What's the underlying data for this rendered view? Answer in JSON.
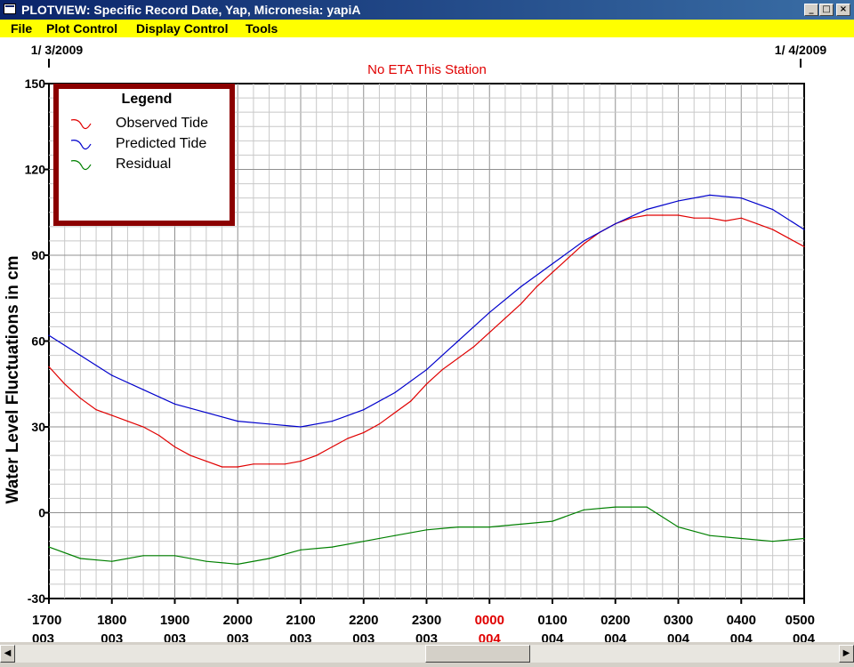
{
  "window": {
    "title": "PLOTVIEW: Specific Record Date, Yap, Micronesia: yapiA",
    "buttons": {
      "minimize": "_",
      "maximize": "□",
      "close": "×"
    }
  },
  "menu": [
    "File",
    "Plot Control",
    "Display Control",
    "Tools"
  ],
  "header": {
    "date_left": "1/ 3/2009",
    "date_right": "1/ 4/2009",
    "status": "No ETA This Station"
  },
  "chart_data": {
    "type": "line",
    "ylabel": "Water Level Fluctuations in cm",
    "ylim": [
      -30,
      150
    ],
    "yticks": [
      "150",
      "120",
      "90",
      "60",
      "30",
      "0",
      "-30"
    ],
    "xlim": [
      0,
      12
    ],
    "xticks": [
      {
        "time": "1700",
        "day": "003",
        "highlight": false
      },
      {
        "time": "1800",
        "day": "003",
        "highlight": false
      },
      {
        "time": "1900",
        "day": "003",
        "highlight": false
      },
      {
        "time": "2000",
        "day": "003",
        "highlight": false
      },
      {
        "time": "2100",
        "day": "003",
        "highlight": false
      },
      {
        "time": "2200",
        "day": "003",
        "highlight": false
      },
      {
        "time": "2300",
        "day": "003",
        "highlight": false
      },
      {
        "time": "0000",
        "day": "004",
        "highlight": true
      },
      {
        "time": "0100",
        "day": "004",
        "highlight": false
      },
      {
        "time": "0200",
        "day": "004",
        "highlight": false
      },
      {
        "time": "0300",
        "day": "004",
        "highlight": false
      },
      {
        "time": "0400",
        "day": "004",
        "highlight": false
      },
      {
        "time": "0500",
        "day": "004",
        "highlight": false
      }
    ],
    "legend": {
      "title": "Legend",
      "position": "top-left"
    },
    "grid": true,
    "series": [
      {
        "name": "Observed Tide",
        "color": "#e00000",
        "x": [
          0,
          0.25,
          0.5,
          0.75,
          1,
          1.25,
          1.5,
          1.75,
          2,
          2.25,
          2.5,
          2.75,
          3,
          3.25,
          3.5,
          3.75,
          4,
          4.25,
          4.5,
          4.75,
          5,
          5.25,
          5.5,
          5.75,
          6,
          6.25,
          6.5,
          6.75,
          7,
          7.25,
          7.5,
          7.75,
          8,
          8.25,
          8.5,
          8.75,
          9,
          9.25,
          9.5,
          9.75,
          10,
          10.25,
          10.5,
          10.75,
          11,
          11.25,
          11.5,
          11.75,
          12
        ],
        "y": [
          51,
          45,
          40,
          36,
          34,
          32,
          30,
          27,
          23,
          20,
          18,
          16,
          16,
          17,
          17,
          17,
          18,
          20,
          23,
          26,
          28,
          31,
          35,
          39,
          45,
          50,
          54,
          58,
          63,
          68,
          73,
          79,
          84,
          89,
          94,
          98,
          101,
          103,
          104,
          104,
          104,
          103,
          103,
          102,
          103,
          101,
          99,
          96,
          93
        ]
      },
      {
        "name": "Predicted Tide",
        "color": "#0000cc",
        "x": [
          0,
          0.5,
          1,
          1.5,
          2,
          2.5,
          3,
          3.5,
          4,
          4.5,
          5,
          5.5,
          6,
          6.5,
          7,
          7.5,
          8,
          8.5,
          9,
          9.5,
          10,
          10.5,
          11,
          11.5,
          12
        ],
        "y": [
          62,
          55,
          48,
          43,
          38,
          35,
          32,
          31,
          30,
          32,
          36,
          42,
          50,
          60,
          70,
          79,
          87,
          95,
          101,
          106,
          109,
          111,
          110,
          106,
          99
        ]
      },
      {
        "name": "Residual",
        "color": "#008000",
        "x": [
          0,
          0.5,
          1,
          1.5,
          2,
          2.5,
          3,
          3.5,
          4,
          4.5,
          5,
          5.5,
          6,
          6.5,
          7,
          7.5,
          8,
          8.5,
          9,
          9.5,
          10,
          10.5,
          11,
          11.5,
          12
        ],
        "y": [
          -12,
          -16,
          -17,
          -15,
          -15,
          -17,
          -18,
          -16,
          -13,
          -12,
          -10,
          -8,
          -6,
          -5,
          -5,
          -4,
          -3,
          1,
          2,
          2,
          -5,
          -8,
          -9,
          -10,
          -9
        ]
      }
    ]
  }
}
